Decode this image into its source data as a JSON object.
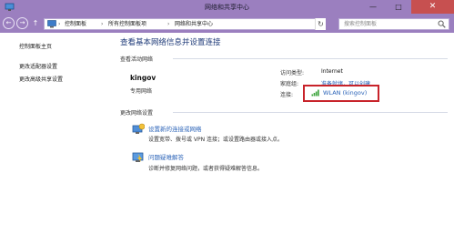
{
  "window": {
    "title": "网络和共享中心",
    "min_glyph": "—",
    "max_glyph": "□",
    "close_glyph": "✕"
  },
  "nav": {
    "back_glyph": "←",
    "forward_glyph": "→",
    "up_glyph": "↑",
    "breadcrumbs": [
      "控制面板",
      "所有控制面板项",
      "网络和共享中心"
    ],
    "sep_glyph": "›",
    "lead_sep_glyph": "›",
    "dropdown_glyph": "▾",
    "refresh_glyph": "↻",
    "search_placeholder": "搜索控制面板"
  },
  "sidebar": {
    "items": [
      {
        "label": "控制面板主页"
      },
      {
        "label": "更改适配器设置"
      },
      {
        "label": "更改高级共享设置"
      }
    ]
  },
  "main": {
    "heading": "查看基本网络信息并设置连接",
    "active_networks_label": "查看活动网络",
    "network": {
      "name": "kingov",
      "type": "专用网络",
      "access_type_label": "访问类型:",
      "access_type_value": "Internet",
      "homegroup_label": "家庭组:",
      "homegroup_value": "准备就绪，可以创建",
      "connection_label": "连接:",
      "connection_value": "WLAN (kingov)"
    },
    "change_settings_label": "更改网络设置",
    "tasks": [
      {
        "title": "设置新的连接或网络",
        "desc": "设置宽带、拨号或 VPN 连接；或设置路由器或接入点。"
      },
      {
        "title": "问题疑难解答",
        "desc": "诊断并修复网络问题，或者获得疑难解答信息。"
      }
    ]
  },
  "colors": {
    "titlebar": "#9b7fbf",
    "close_button": "#c75050",
    "link": "#2c64b8",
    "heading": "#1e3a78",
    "highlight": "#c8232a"
  }
}
